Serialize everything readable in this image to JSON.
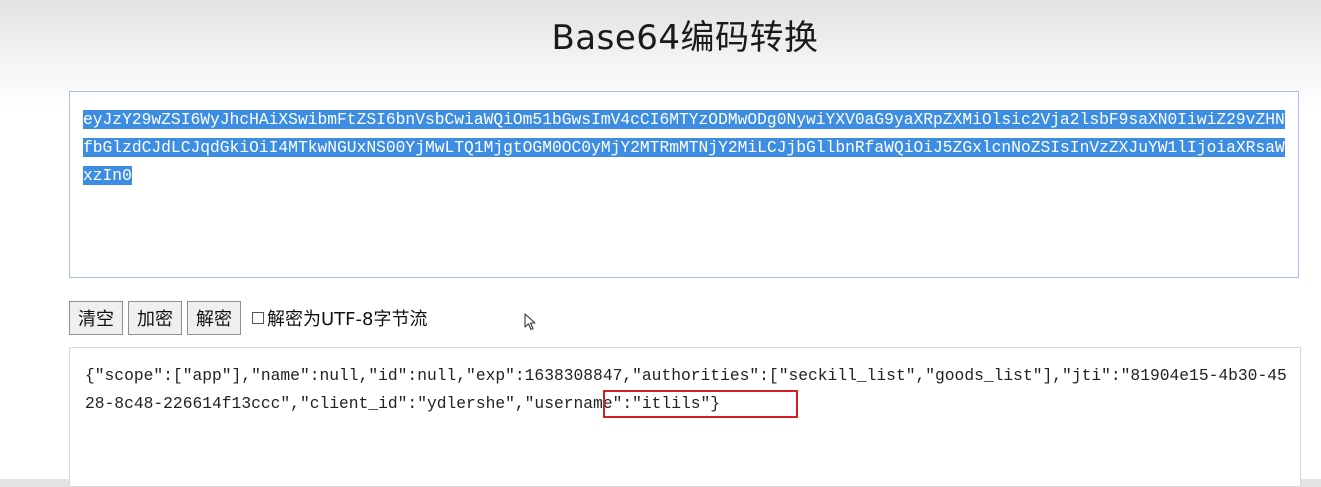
{
  "page": {
    "title": "Base64编码转换"
  },
  "input": {
    "text": "eyJzY29wZSI6WyJhcHAiXSwibmFtZSI6bnVsbCwiaWQiOm51bGwsImV4cCI6MTYzODMwODg0NywiYXV0aG9yaXRpZXMiOlsic2Vja2lsbF9saXN0IiwiZ29vZHNfbGlzdCJdLCJqdGkiOiI4MTkwNGUxNS00YjMwLTQ1MjgtOGM0OC0yMjY2MTRmMTNjY2MiLCJjbGllbnRfaWQiOiJ5ZGxlcnNoZSIsInVzZXJuYW1lIjoiaXRsaWxzIn0",
    "selected": true,
    "highlight_color": "#3d8ee2"
  },
  "toolbar": {
    "clear_label": "清空",
    "encode_label": "加密",
    "decode_label": "解密",
    "utf8_checkbox_label": "解密为UTF-8字节流",
    "utf8_checked": false
  },
  "output": {
    "text": "{\"scope\":[\"app\"],\"name\":null,\"id\":null,\"exp\":1638308847,\"authorities\":[\"seckill_list\",\"goods_list\"],\"jti\":\"81904e15-4b30-4528-8c48-226614f13ccc\",\"client_id\":\"ydlershe\",\"username\":\"itlils\"}",
    "annotation_color": "#d81e1e"
  }
}
